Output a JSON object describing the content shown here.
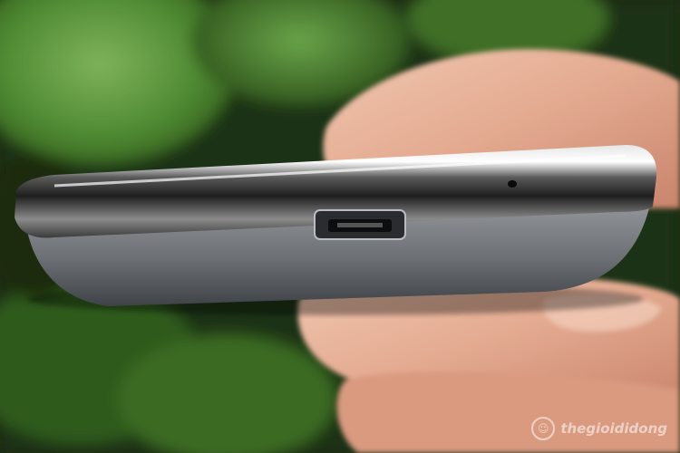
{
  "photo": {
    "subject": "phone-bottom-edge",
    "watermark": {
      "text": "thegioididong",
      "icon": "smiley-logo-icon"
    }
  }
}
